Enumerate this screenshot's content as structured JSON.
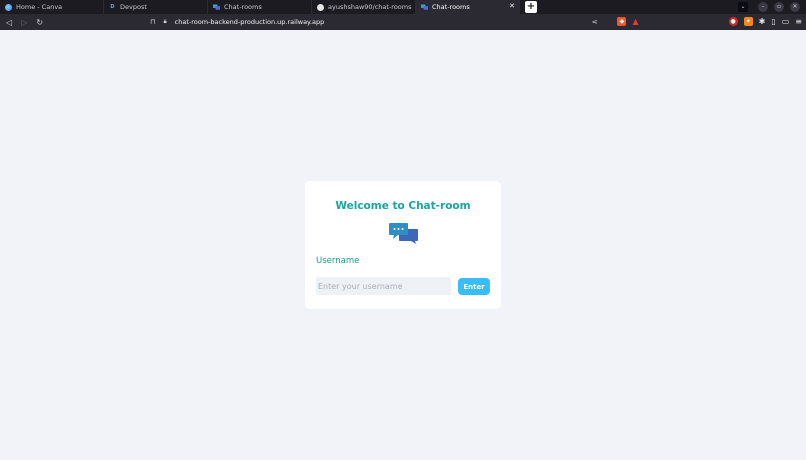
{
  "browser": {
    "tabs": [
      {
        "title": "Home - Canva",
        "favicon": "canva-icon"
      },
      {
        "title": "Devpost",
        "favicon": "devpost-icon"
      },
      {
        "title": "Chat-rooms",
        "favicon": "chat-icon"
      },
      {
        "title": "ayushshaw90/chat-rooms",
        "favicon": "github-icon"
      },
      {
        "title": "Chat-rooms",
        "favicon": "chat-icon",
        "active": true
      }
    ],
    "url": "chat-room-backend-production.up.railway.app"
  },
  "page": {
    "title": "Welcome to Chat-room",
    "username_label": "Username",
    "username_placeholder": "Enter your username",
    "enter_label": "Enter"
  },
  "colors": {
    "title": "#19a7a0",
    "label": "#17a38c",
    "button": "#38bdf8",
    "background": "#f1f3f8"
  }
}
